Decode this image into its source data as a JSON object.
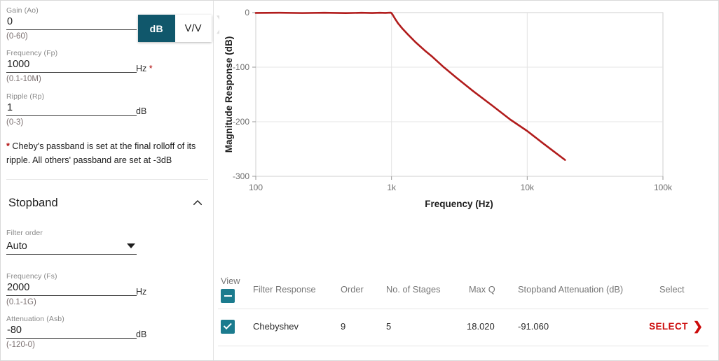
{
  "sidebar": {
    "collapse_handle_icon": "chevron-right-icon",
    "unit_toggle": {
      "db_label": "dB",
      "vv_label": "V/V",
      "selected": "dB"
    },
    "fields": [
      {
        "label": "Gain (Ao)",
        "value": "0",
        "hint": "(0-60)",
        "unit": "",
        "required": false
      },
      {
        "label": "Frequency (Fp)",
        "value": "1000",
        "hint": "(0.1-10M)",
        "unit": "Hz",
        "required": true
      },
      {
        "label": "Ripple (Rp)",
        "value": "1",
        "hint": "(0-3)",
        "unit": "dB",
        "required": false
      }
    ],
    "footnote": {
      "star": "*",
      "text": " Cheby's passband is set at the final rolloff of its ripple. All others' passband are set at -3dB"
    },
    "stopband": {
      "title": "Stopband",
      "chevron_icon": "chevron-up-icon",
      "filter_order": {
        "label": "Filter order",
        "value": "Auto",
        "caret_icon": "chevron-down-icon"
      },
      "fields": [
        {
          "label": "Frequency (Fs)",
          "value": "2000",
          "hint": "(0.1-1G)",
          "unit": "Hz"
        },
        {
          "label": "Attenuation (Asb)",
          "value": "-80",
          "hint": "(-120-0)",
          "unit": "dB"
        }
      ]
    }
  },
  "chart_data": {
    "type": "line",
    "title": "",
    "xlabel": "Frequency (Hz)",
    "ylabel": "Magnitude Response (dB)",
    "xscale": "log",
    "xlim": [
      100,
      100000
    ],
    "ylim": [
      -300,
      0
    ],
    "xticks": [
      100,
      1000,
      10000,
      100000
    ],
    "xticklabels": [
      "100",
      "1k",
      "10k",
      "100k"
    ],
    "yticks": [
      0,
      -100,
      -200,
      -300
    ],
    "yticklabels": [
      "0",
      "-100",
      "-200",
      "-300"
    ],
    "grid": true,
    "legend": "none",
    "series": [
      {
        "name": "Chebyshev",
        "color": "#b11c1c",
        "x": [
          100,
          150,
          220,
          320,
          460,
          600,
          720,
          820,
          900,
          950,
          990,
          1000,
          1020,
          1060,
          1120,
          1200,
          1320,
          1500,
          1750,
          2000,
          2400,
          3000,
          4000,
          5500,
          7500,
          10000,
          13000,
          16000,
          19000
        ],
        "y": [
          -0.6,
          -0.3,
          -0.8,
          -0.2,
          -0.9,
          -0.3,
          -0.7,
          -0.2,
          -0.5,
          -0.2,
          -0.1,
          -1.0,
          -4.0,
          -11.0,
          -20.0,
          -29.0,
          -40.0,
          -54.0,
          -69.0,
          -81.0,
          -99.0,
          -119.0,
          -144.0,
          -170.0,
          -196.0,
          -217.0,
          -239.0,
          -256.0,
          -270.0
        ]
      }
    ]
  },
  "table": {
    "view_label": "View",
    "header_checkbox_state": "indeterminate",
    "columns": [
      "Filter Response",
      "Order",
      "No. of Stages",
      "Max Q",
      "Stopband Attenuation (dB)",
      "Select"
    ],
    "rows": [
      {
        "checked": true,
        "filter_response": "Chebyshev",
        "order": "9",
        "stages": "5",
        "max_q": "18.020",
        "stopband_attenuation": "-91.060",
        "select_label": "SELECT",
        "select_arrow_icon": "chevron-right-icon"
      }
    ]
  },
  "colors": {
    "teal": "#1b7b8e",
    "teal_dark": "#10576b",
    "curve_red": "#b11c1c",
    "link_red": "#cc0b0b"
  }
}
